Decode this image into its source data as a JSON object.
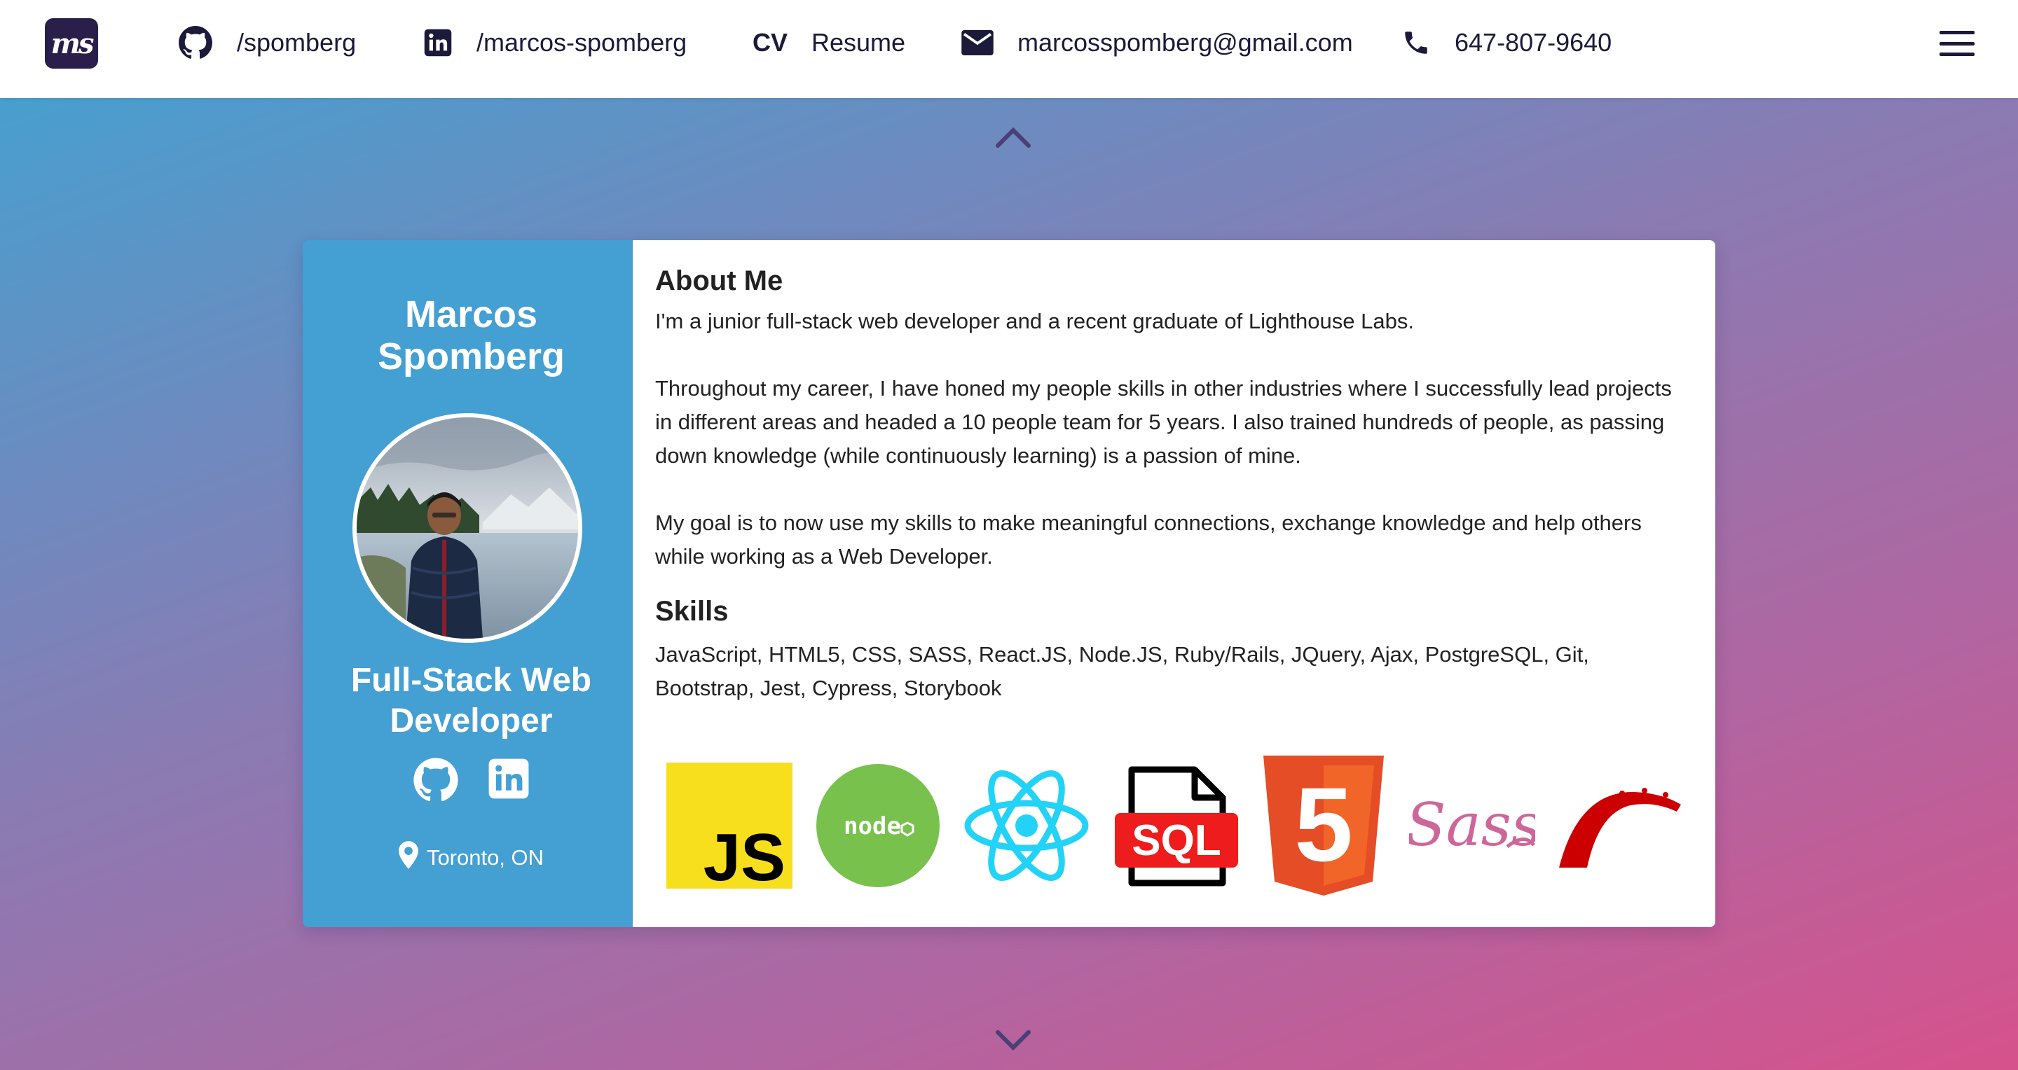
{
  "navbar": {
    "logo_text": "ms",
    "github_label": "/spomberg",
    "linkedin_label": "/marcos-spomberg",
    "cv_mark": "CV",
    "resume_label": "Resume",
    "email_label": "marcosspomberg@gmail.com",
    "phone_label": "647-807-9640"
  },
  "profile": {
    "name": "Marcos Spomberg",
    "title": "Full-Stack Web Developer",
    "location": "Toronto, ON"
  },
  "about": {
    "heading": "About Me",
    "paragraphs": [
      "I'm a junior full-stack web developer and a recent graduate of Lighthouse Labs.",
      "Throughout my career, I have honed my people skills in other industries where I successfully lead projects in different areas and headed a 10 people team for 5 years. I also trained hundreds of people, as passing down knowledge (while continuously learning) is a passion of mine.",
      "My goal is to now use my skills to make meaningful connections, exchange knowledge and help others while working as a Web Developer."
    ]
  },
  "skills": {
    "heading": "Skills",
    "text": "JavaScript, HTML5, CSS, SASS, React.JS, Node.JS, Ruby/Rails, JQuery, Ajax, PostgreSQL, Git, Bootstrap, Jest, Cypress, Storybook",
    "logos": {
      "js": "JS",
      "node": "node",
      "sql": "SQL",
      "html5": "5",
      "sass": "Sass"
    }
  },
  "colors": {
    "nav_text": "#1c1a3a",
    "sidebar": "#449fd2",
    "gradient_start": "#489fcf",
    "gradient_end": "#d6528c"
  }
}
